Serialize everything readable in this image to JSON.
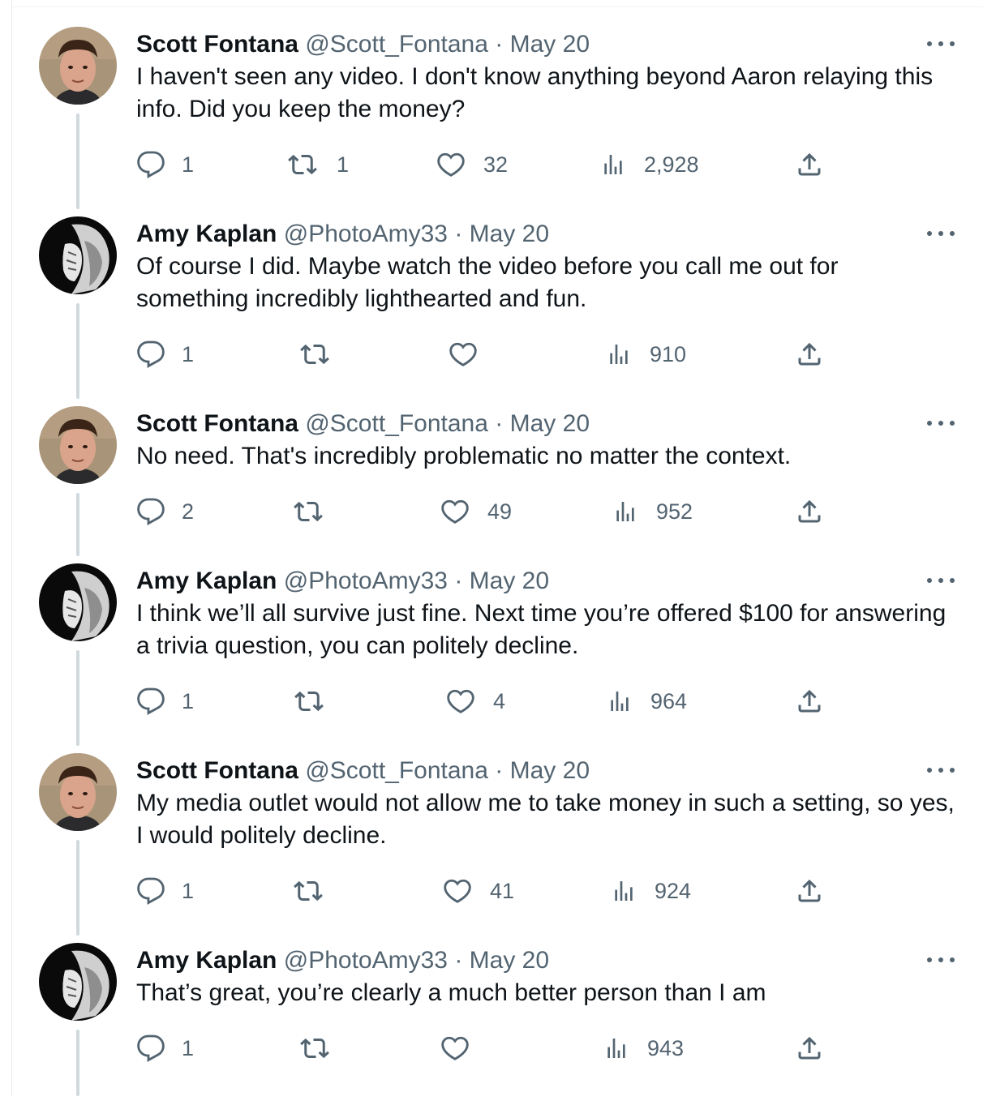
{
  "more_label": "More",
  "tweets": [
    {
      "name": "Scott Fontana",
      "handle": "@Scott_Fontana",
      "sep": "·",
      "date": "May 20",
      "text": "I haven't seen any video. I don't know anything beyond Aaron relaying this info. Did you keep the money?",
      "replies": "1",
      "retweets": "1",
      "likes": "32",
      "views": "2,928",
      "avatar": "man-portrait"
    },
    {
      "name": "Amy Kaplan",
      "handle": "@PhotoAmy33",
      "sep": "·",
      "date": "May 20",
      "text": "Of course I did. Maybe watch the video before you call me out for something incredibly lighthearted and fun.",
      "replies": "1",
      "retweets": "",
      "likes": "",
      "views": "910",
      "avatar": "bw-portrait"
    },
    {
      "name": "Scott Fontana",
      "handle": "@Scott_Fontana",
      "sep": "·",
      "date": "May 20",
      "text": "No need. That's incredibly problematic no matter the context.",
      "replies": "2",
      "retweets": "",
      "likes": "49",
      "views": "952",
      "avatar": "man-portrait"
    },
    {
      "name": "Amy Kaplan",
      "handle": "@PhotoAmy33",
      "sep": "·",
      "date": "May 20",
      "text": "I think we’ll all survive just fine. Next time you’re offered $100 for answering a trivia question, you can politely decline.",
      "replies": "1",
      "retweets": "",
      "likes": "4",
      "views": "964",
      "avatar": "bw-portrait"
    },
    {
      "name": "Scott Fontana",
      "handle": "@Scott_Fontana",
      "sep": "·",
      "date": "May 20",
      "text": "My media outlet would not allow me to take money in such a setting, so yes, I would politely decline.",
      "replies": "1",
      "retweets": "",
      "likes": "41",
      "views": "924",
      "avatar": "man-portrait"
    },
    {
      "name": "Amy Kaplan",
      "handle": "@PhotoAmy33",
      "sep": "·",
      "date": "May 20",
      "text": "That’s great, you’re clearly a much better person than I am",
      "replies": "1",
      "retweets": "",
      "likes": "",
      "views": "943",
      "avatar": "bw-portrait"
    }
  ],
  "colors": {
    "text": "#0f1419",
    "muted": "#536471",
    "thread_line": "#cfd9de"
  }
}
